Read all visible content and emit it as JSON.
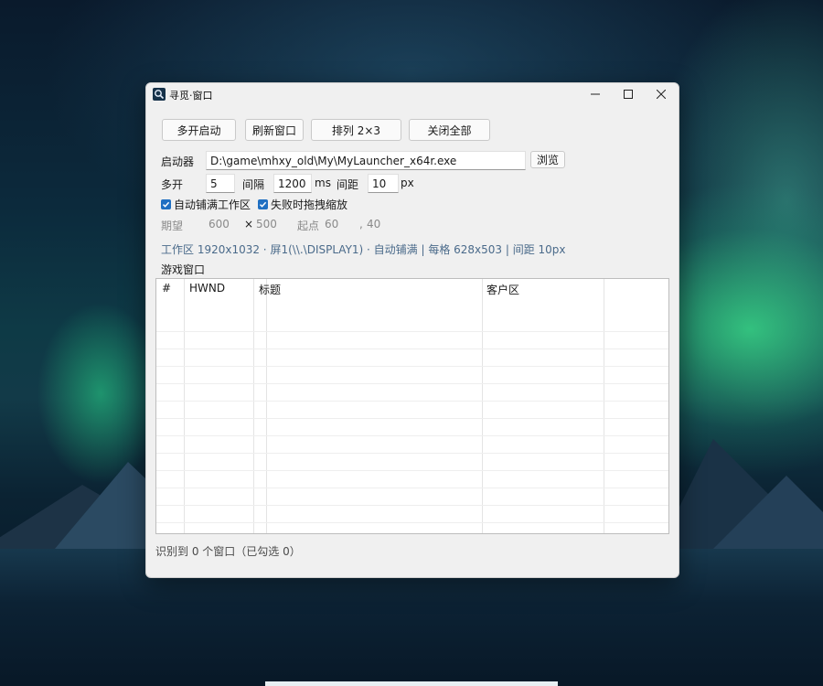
{
  "window": {
    "title": "寻觅·窗口",
    "controls": {
      "minimize": "—",
      "maximize": "☐",
      "close": "✕"
    }
  },
  "toolbar": {
    "multi_launch": "多开启动",
    "refresh_windows": "刷新窗口",
    "arrange": "排列 2×3",
    "close_all": "关闭全部"
  },
  "launcher": {
    "label": "启动器",
    "path": "D:\\game\\mhxy_old\\My\\MyLauncher_x64r.exe",
    "browse": "浏览"
  },
  "multi": {
    "label": "多开",
    "count": "5",
    "interval_label": "间隔",
    "interval": "1200",
    "interval_unit": "ms",
    "gap_label": "间距",
    "gap": "10",
    "gap_unit": "px"
  },
  "options": {
    "auto_fill": {
      "label": "自动铺满工作区",
      "checked": true
    },
    "drag_scale": {
      "label": "失败时拖拽缩放",
      "checked": true
    }
  },
  "expect": {
    "label": "期望",
    "width": "600",
    "times": "×",
    "height": "500",
    "origin_label": "起点",
    "origin_x": "60",
    "comma": ",",
    "origin_y": "40"
  },
  "status_line": "工作区 1920x1032 · 屏1(\\\\.\\DISPLAY1) · 自动铺满 | 每格 628x503 | 间距 10px",
  "list": {
    "section_label": "游戏窗口",
    "columns": [
      "#",
      "HWND",
      "标题",
      "客户区"
    ],
    "rows": []
  },
  "footer": "识别到 0 个窗口（已勾选 0）",
  "colors": {
    "accent": "#1f6fc2",
    "status_text": "#4a6a8a"
  },
  "icons": {
    "app": "magnifier-icon",
    "checkbox": "checkmark-icon"
  }
}
